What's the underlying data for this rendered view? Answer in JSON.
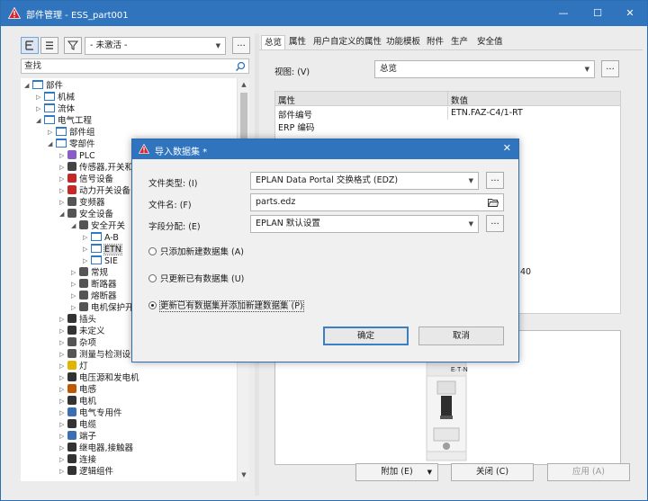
{
  "window": {
    "title": "部件管理 - ESS_part001",
    "minimize_icon": "minimize-icon",
    "maximize_icon": "maximize-icon",
    "close_icon": "close-icon"
  },
  "left_panel": {
    "filter_value": "- 未激活 -",
    "more_button": "...",
    "search_placeholder": "查找",
    "tree": [
      {
        "label": "部件",
        "level": 0,
        "expanded": true,
        "icon": "folder-icon"
      },
      {
        "label": "机械",
        "level": 1,
        "expanded": false,
        "icon": "folder-icon"
      },
      {
        "label": "流体",
        "level": 1,
        "expanded": false,
        "icon": "folder-icon"
      },
      {
        "label": "电气工程",
        "level": 1,
        "expanded": true,
        "icon": "folder-icon"
      },
      {
        "label": "部件组",
        "level": 2,
        "expanded": false,
        "icon": "folder-icon"
      },
      {
        "label": "零部件",
        "level": 2,
        "expanded": true,
        "icon": "folder-icon"
      },
      {
        "label": "PLC",
        "level": 3,
        "expanded": false,
        "icon": "plc-icon"
      },
      {
        "label": "传感器,开关和",
        "level": 3,
        "expanded": false,
        "icon": "sensor-icon"
      },
      {
        "label": "信号设备",
        "level": 3,
        "expanded": false,
        "icon": "signal-device-icon"
      },
      {
        "label": "动力开关设备",
        "level": 3,
        "expanded": false,
        "icon": "power-switch-icon"
      },
      {
        "label": "变频器",
        "level": 3,
        "expanded": false,
        "icon": "inverter-icon"
      },
      {
        "label": "安全设备",
        "level": 3,
        "expanded": true,
        "icon": "safety-device-icon"
      },
      {
        "label": "安全开关",
        "level": 4,
        "expanded": true,
        "icon": "safety-switch-icon"
      },
      {
        "label": "A-B",
        "level": 5,
        "expanded": false,
        "icon": "folder-icon"
      },
      {
        "label": "ETN",
        "level": 5,
        "expanded": false,
        "icon": "folder-icon",
        "selected": true
      },
      {
        "label": "SIE",
        "level": 5,
        "expanded": false,
        "icon": "folder-icon"
      },
      {
        "label": "常规",
        "level": 4,
        "expanded": false,
        "icon": "general-icon"
      },
      {
        "label": "断路器",
        "level": 4,
        "expanded": false,
        "icon": "circuit-breaker-icon"
      },
      {
        "label": "熔断器",
        "level": 4,
        "expanded": false,
        "icon": "fuse-icon"
      },
      {
        "label": "电机保护开关",
        "level": 4,
        "expanded": false,
        "icon": "motor-protection-icon"
      },
      {
        "label": "插头",
        "level": 3,
        "expanded": false,
        "icon": "plug-icon"
      },
      {
        "label": "未定义",
        "level": 3,
        "expanded": false,
        "icon": "undefined-icon"
      },
      {
        "label": "杂项",
        "level": 3,
        "expanded": false,
        "icon": "misc-icon"
      },
      {
        "label": "测量与检测设",
        "level": 3,
        "expanded": false,
        "icon": "measurement-icon"
      },
      {
        "label": "灯",
        "level": 3,
        "expanded": false,
        "icon": "lamp-icon"
      },
      {
        "label": "电压源和发电机",
        "level": 3,
        "expanded": false,
        "icon": "voltage-source-icon"
      },
      {
        "label": "电感",
        "level": 3,
        "expanded": false,
        "icon": "inductor-icon"
      },
      {
        "label": "电机",
        "level": 3,
        "expanded": false,
        "icon": "motor-icon"
      },
      {
        "label": "电气专用件",
        "level": 3,
        "expanded": false,
        "icon": "electrical-special-icon"
      },
      {
        "label": "电缆",
        "level": 3,
        "expanded": false,
        "icon": "cable-icon"
      },
      {
        "label": "端子",
        "level": 3,
        "expanded": false,
        "icon": "terminal-icon"
      },
      {
        "label": "继电器,接触器",
        "level": 3,
        "expanded": false,
        "icon": "relay-icon"
      },
      {
        "label": "连接",
        "level": 3,
        "expanded": false,
        "icon": "connection-icon"
      },
      {
        "label": "逻辑组件",
        "level": 3,
        "expanded": false,
        "icon": "logic-icon"
      }
    ]
  },
  "right_panel": {
    "tabs": [
      "总览",
      "属性",
      "用户自定义的属性",
      "功能模板",
      "附件",
      "生产",
      "安全值"
    ],
    "active_tab": "总览",
    "view_label": "视图: (V)",
    "view_value": "总览",
    "view_more": "...",
    "grid_headers": [
      "属性",
      "数值"
    ],
    "grid_rows": [
      {
        "property": "部件编号",
        "value": "ETN.FAZ-C4/1-RT"
      },
      {
        "property": "ERP 编码",
        "value": ""
      }
    ],
    "partial_value_text": "40",
    "buttons": {
      "attach": "附加 (E)",
      "close": "关闭 (C)",
      "apply": "应用 (A)"
    }
  },
  "dialog": {
    "title": "导入数据集 *",
    "close_icon": "close-icon",
    "file_type_label": "文件类型: (I)",
    "file_type_value": "EPLAN Data Portal 交换格式 (EDZ)",
    "file_name_label": "文件名: (F)",
    "file_name_value": "parts.edz",
    "field_assign_label": "字段分配: (E)",
    "field_assign_value": "EPLAN 默认设置",
    "more_button": "...",
    "options": [
      {
        "label": "只添加新建数据集 (A)",
        "checked": false
      },
      {
        "label": "只更新已有数据集 (U)",
        "checked": false
      },
      {
        "label": "更新已有数据集并添加新建数据集 (P)",
        "checked": true
      }
    ],
    "ok_button": "确定",
    "cancel_button": "取消"
  }
}
